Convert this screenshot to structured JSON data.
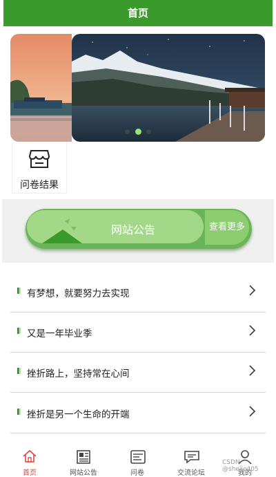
{
  "header": {
    "title": "首页"
  },
  "carousel": {
    "active_index": 1,
    "dot_count": 3
  },
  "quick_entry": {
    "label": "问卷结果",
    "icon": "store-icon"
  },
  "notice_banner": {
    "title": "网站公告",
    "more_label": "查看更多"
  },
  "notices": [
    {
      "title": "有梦想，就要努力去实现"
    },
    {
      "title": "又是一年毕业季"
    },
    {
      "title": "挫折路上，坚持常在心间"
    },
    {
      "title": "挫折是另一个生命的开端"
    }
  ],
  "tabbar": [
    {
      "label": "首页",
      "icon": "home-icon",
      "active": true
    },
    {
      "label": "网站公告",
      "icon": "newspaper-icon",
      "active": false
    },
    {
      "label": "问卷",
      "icon": "survey-icon",
      "active": false
    },
    {
      "label": "交流论坛",
      "icon": "chat-icon",
      "active": false
    },
    {
      "label": "我的",
      "icon": "user-icon",
      "active": false
    }
  ],
  "watermark": "CSDN @shejie405",
  "colors": {
    "primary": "#3a9a2c",
    "tab_active": "#e0413a",
    "notice_light": "#a4d889",
    "notice_dark": "#6ab558"
  }
}
